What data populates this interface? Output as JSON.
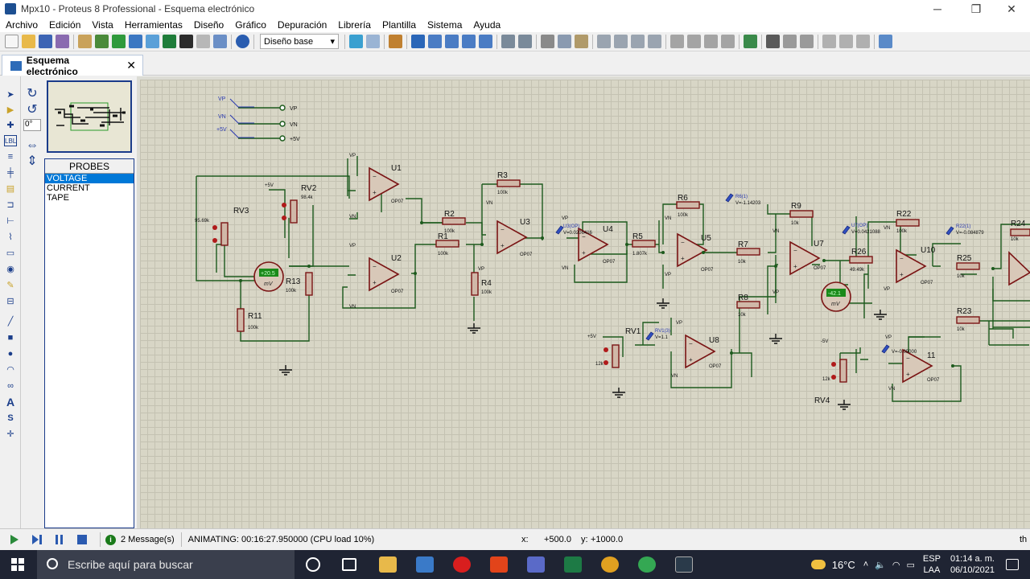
{
  "window": {
    "title": "Mpx10 - Proteus 8 Professional - Esquema electrónico",
    "minimize": "─",
    "maximize": "❐",
    "close": "✕"
  },
  "menu": [
    "Archivo",
    "Edición",
    "Vista",
    "Herramientas",
    "Diseño",
    "Gráfico",
    "Depuración",
    "Librería",
    "Plantilla",
    "Sistema",
    "Ayuda"
  ],
  "toolbar": {
    "style_select": "Diseño base"
  },
  "tab": {
    "label": "Esquema electrónico",
    "close": "✕"
  },
  "left_panel": {
    "angle": "0°",
    "probes_header": "PROBES",
    "probes": [
      "VOLTAGE",
      "CURRENT",
      "TAPE"
    ],
    "selected": "VOLTAGE"
  },
  "schematic": {
    "rails": [
      "VP",
      "VN",
      "+5V"
    ],
    "parts": {
      "U1": "U1",
      "U2": "U2",
      "U3": "U3",
      "U4": "U4",
      "U5": "U5",
      "U7": "U7",
      "U8": "U8",
      "U10": "U10",
      "U11": "11",
      "op": "OP07",
      "R1": "R1",
      "R2": "R2",
      "R3": "R3",
      "R4": "R4",
      "R5": "R5",
      "R6": "R6",
      "R7": "R7",
      "R8": "R8",
      "R9": "R9",
      "R11": "R11",
      "R13": "R13",
      "R22": "R22",
      "R23": "R23",
      "R24": "R24",
      "R25": "R25",
      "R26": "R26",
      "RV1": "RV1",
      "RV2": "RV2",
      "RV3": "RV3",
      "RV4": "RV4"
    },
    "values": {
      "v100k": "100k",
      "v10k": "10k",
      "v1807k": "1.807k",
      "v4949k": "49.49k",
      "v9569k": "95.69k",
      "v984k": "98.4k",
      "v12k": "12k"
    },
    "probes": {
      "u3": "U3(OP)",
      "u3v": "V=0.0206416",
      "r6": "R6(1)",
      "r6v": "V=-1.14203",
      "u7": "U7(OP)",
      "u7v": "V=0.0421088",
      "r22": "R22(1)",
      "r22v": "V=-0.084879",
      "rv1": "RV1(3)",
      "rv1v": "V=1.1",
      "u11v": "V=-0.05000"
    },
    "meters": {
      "m1": "+20.5",
      "m2": "-42.1",
      "unit": "mV"
    },
    "supplies": {
      "p5": "+5V",
      "n5": "-5V",
      "VP": "VP",
      "VN": "VN"
    }
  },
  "status": {
    "messages": "2 Message(s)",
    "animating": "ANIMATING: 00:16:27.950000 (CPU load 10%)",
    "x_label": "x:",
    "x_value": "+500.0",
    "y_label": "y:",
    "y_value": "+1000.0",
    "right": "th"
  },
  "taskbar": {
    "search_placeholder": "Escribe aquí para buscar",
    "temperature": "16°C",
    "lang_top": "ESP",
    "lang_bottom": "LAA",
    "time": "01:14 a. m.",
    "date": "06/10/2021"
  }
}
